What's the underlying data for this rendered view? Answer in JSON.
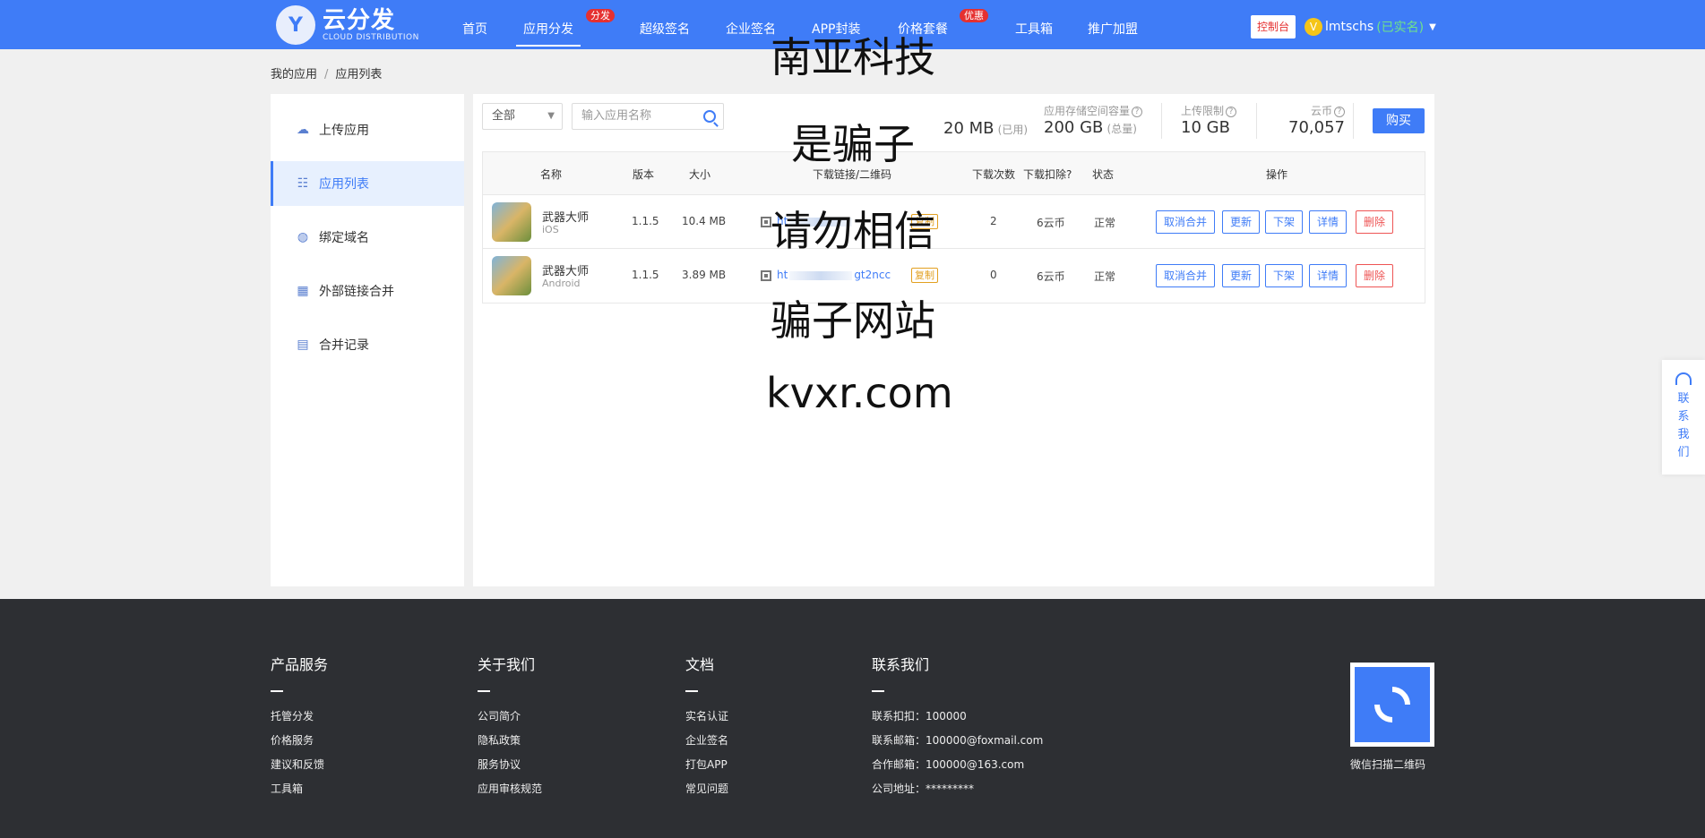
{
  "brand": {
    "logo_letter": "Y",
    "name": "云分发",
    "tagline": "CLOUD DISTRIBUTION"
  },
  "nav": {
    "items": [
      {
        "label": "首页"
      },
      {
        "label": "应用分发",
        "badge": "分发"
      },
      {
        "label": "超级签名"
      },
      {
        "label": "企业签名"
      },
      {
        "label": "APP封装"
      },
      {
        "label": "价格套餐",
        "badge": "优惠"
      },
      {
        "label": "工具箱"
      },
      {
        "label": "推广加盟"
      }
    ],
    "console_label": "控制台",
    "user_initial": "V",
    "username": "lmtschs",
    "verified": "(已实名)"
  },
  "breadcrumb": {
    "root": "我的应用",
    "sep": "/",
    "current": "应用列表"
  },
  "sidebar": {
    "items": [
      {
        "label": "上传应用",
        "icon": "cloud-upload-icon"
      },
      {
        "label": "应用列表",
        "icon": "app-list-icon"
      },
      {
        "label": "绑定域名",
        "icon": "globe-icon"
      },
      {
        "label": "外部链接合并",
        "icon": "qr-merge-icon"
      },
      {
        "label": "合并记录",
        "icon": "clipboard-icon"
      }
    ]
  },
  "toolbar": {
    "filter_value": "全部",
    "search_placeholder": "输入应用名称"
  },
  "stats": {
    "used_value": "20 MB",
    "used_sub": "(已用)",
    "storage_label": "应用存储空间容量",
    "storage_value": "200 GB",
    "storage_sub": "(总量)",
    "upload_label": "上传限制",
    "upload_value": "10 GB",
    "coin_label": "云币",
    "coin_value": "70,057",
    "buy_label": "购买"
  },
  "table": {
    "headers": [
      "名称",
      "版本",
      "大小",
      "下载链接/二维码",
      "下载次数",
      "下载扣除?",
      "状态",
      "操作"
    ],
    "rows": [
      {
        "name": "武器大师",
        "platform": "iOS",
        "version": "1.1.5",
        "size": "10.4 MB",
        "link_prefix": "ht",
        "link_suffix": "",
        "copy": "复制",
        "downloads": "2",
        "deduct": "6云币",
        "status": "正常"
      },
      {
        "name": "武器大师",
        "platform": "Android",
        "version": "1.1.5",
        "size": "3.89 MB",
        "link_prefix": "ht",
        "link_suffix": "gt2ncc",
        "copy": "复制",
        "downloads": "0",
        "deduct": "6云币",
        "status": "正常"
      }
    ],
    "actions": [
      "取消合并",
      "更新",
      "下架",
      "详情",
      "删除"
    ]
  },
  "watermark": [
    "南亚科技",
    "是骗子",
    "请勿相信",
    "骗子网站",
    "kvxr.com"
  ],
  "contact_float": {
    "chars": [
      "联",
      "系",
      "我",
      "们"
    ]
  },
  "footer": {
    "columns": [
      {
        "title": "产品服务",
        "items": [
          "托管分发",
          "价格服务",
          "建议和反馈",
          "工具箱"
        ]
      },
      {
        "title": "关于我们",
        "items": [
          "公司简介",
          "隐私政策",
          "服务协议",
          "应用审核规范"
        ]
      },
      {
        "title": "文档",
        "items": [
          "实名认证",
          "企业签名",
          "打包APP",
          "常见问题"
        ]
      },
      {
        "title": "联系我们",
        "items": [
          "联系扣扣：100000",
          "联系邮箱：100000@foxmail.com",
          "合作邮箱：100000@163.com",
          "公司地址：*********"
        ]
      }
    ],
    "qr_caption": "微信扫描二维码"
  },
  "colors": {
    "primary": "#3f7cf7",
    "danger": "#e55555",
    "badge": "#e53030",
    "footer_bg": "#2d2f33"
  }
}
